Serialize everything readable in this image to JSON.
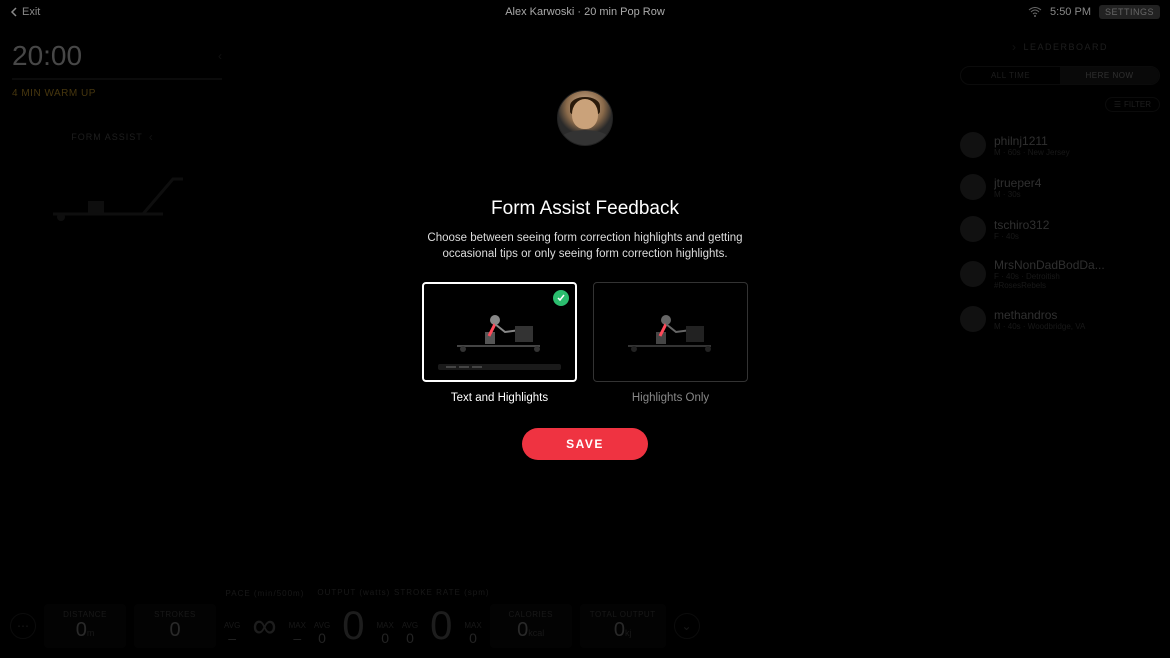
{
  "topbar": {
    "exit": "Exit",
    "title": "Alex Karwoski  ·  20 min Pop Row",
    "time": "5:50 PM",
    "settings": "SETTINGS"
  },
  "timer": {
    "value": "20:00",
    "phase": "4 MIN WARM UP"
  },
  "form_assist_panel": {
    "title": "FORM ASSIST"
  },
  "leaderboard": {
    "title": "LEADERBOARD",
    "toggle": {
      "all": "ALL TIME",
      "now": "HERE NOW"
    },
    "filter": "FILTER",
    "items": [
      {
        "name": "philnj1211",
        "meta": "M · 60s · New Jersey",
        "tag": ""
      },
      {
        "name": "jtrueper4",
        "meta": "M · 30s",
        "tag": ""
      },
      {
        "name": "tschiro312",
        "meta": "F · 40s",
        "tag": ""
      },
      {
        "name": "MrsNonDadBodDa...",
        "meta": "F · 40s · Detroitish",
        "tag": "#RosesRebels"
      },
      {
        "name": "methandros",
        "meta": "M · 40s · Woodbridge, VA",
        "tag": ""
      }
    ]
  },
  "metrics": {
    "distance": {
      "label": "DISTANCE",
      "value": "0",
      "unit": "m"
    },
    "strokes": {
      "label": "STROKES",
      "value": "0"
    },
    "pace": {
      "title": "PACE (min/500m)",
      "avg_label": "AVG",
      "avg_value": "–",
      "main": "∞",
      "max_label": "MAX",
      "max_value": "–"
    },
    "output": {
      "title": "OUTPUT (watts)",
      "avg_label": "AVG",
      "avg_value": "0",
      "main": "0",
      "max_label": "MAX",
      "max_value": "0"
    },
    "stroke_rate": {
      "title": "STROKE RATE (spm)",
      "avg_label": "AVG",
      "avg_value": "0",
      "main": "0",
      "max_label": "MAX",
      "max_value": "0"
    },
    "calories": {
      "label": "CALORIES",
      "value": "0",
      "unit": "kcal"
    },
    "total_output": {
      "label": "TOTAL OUTPUT",
      "value": "0",
      "unit": "kj"
    }
  },
  "modal": {
    "title": "Form Assist Feedback",
    "description": "Choose between seeing form correction highlights and getting occasional tips or only seeing form correction highlights.",
    "option1": "Text and Highlights",
    "option2": "Highlights Only",
    "save": "SAVE"
  }
}
